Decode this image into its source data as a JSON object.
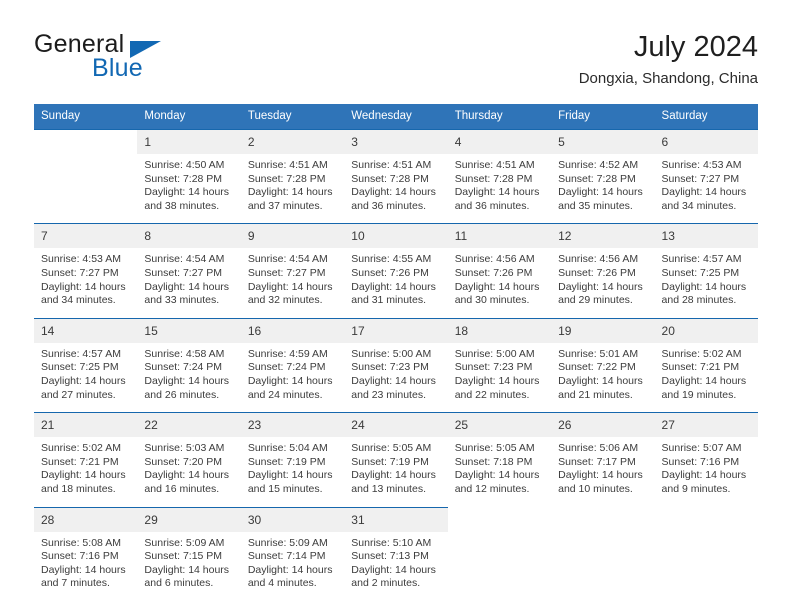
{
  "brand": {
    "name_part1": "General",
    "name_part2": "Blue",
    "logo_icon": "triangle-logo-icon",
    "color": "#1268b3"
  },
  "header": {
    "title": "July 2024",
    "location": "Dongxia, Shandong, China"
  },
  "theme": {
    "header_blue": "#2f74b8",
    "rule_blue": "#1667ad",
    "daynum_band": "#f0f0f0"
  },
  "calendar": {
    "weekdays": [
      "Sunday",
      "Monday",
      "Tuesday",
      "Wednesday",
      "Thursday",
      "Friday",
      "Saturday"
    ],
    "weeks": [
      [
        {
          "day": "",
          "empty": true
        },
        {
          "day": "1",
          "sunrise": "Sunrise: 4:50 AM",
          "sunset": "Sunset: 7:28 PM",
          "daylight1": "Daylight: 14 hours",
          "daylight2": "and 38 minutes."
        },
        {
          "day": "2",
          "sunrise": "Sunrise: 4:51 AM",
          "sunset": "Sunset: 7:28 PM",
          "daylight1": "Daylight: 14 hours",
          "daylight2": "and 37 minutes."
        },
        {
          "day": "3",
          "sunrise": "Sunrise: 4:51 AM",
          "sunset": "Sunset: 7:28 PM",
          "daylight1": "Daylight: 14 hours",
          "daylight2": "and 36 minutes."
        },
        {
          "day": "4",
          "sunrise": "Sunrise: 4:51 AM",
          "sunset": "Sunset: 7:28 PM",
          "daylight1": "Daylight: 14 hours",
          "daylight2": "and 36 minutes."
        },
        {
          "day": "5",
          "sunrise": "Sunrise: 4:52 AM",
          "sunset": "Sunset: 7:28 PM",
          "daylight1": "Daylight: 14 hours",
          "daylight2": "and 35 minutes."
        },
        {
          "day": "6",
          "sunrise": "Sunrise: 4:53 AM",
          "sunset": "Sunset: 7:27 PM",
          "daylight1": "Daylight: 14 hours",
          "daylight2": "and 34 minutes."
        }
      ],
      [
        {
          "day": "7",
          "sunrise": "Sunrise: 4:53 AM",
          "sunset": "Sunset: 7:27 PM",
          "daylight1": "Daylight: 14 hours",
          "daylight2": "and 34 minutes."
        },
        {
          "day": "8",
          "sunrise": "Sunrise: 4:54 AM",
          "sunset": "Sunset: 7:27 PM",
          "daylight1": "Daylight: 14 hours",
          "daylight2": "and 33 minutes."
        },
        {
          "day": "9",
          "sunrise": "Sunrise: 4:54 AM",
          "sunset": "Sunset: 7:27 PM",
          "daylight1": "Daylight: 14 hours",
          "daylight2": "and 32 minutes."
        },
        {
          "day": "10",
          "sunrise": "Sunrise: 4:55 AM",
          "sunset": "Sunset: 7:26 PM",
          "daylight1": "Daylight: 14 hours",
          "daylight2": "and 31 minutes."
        },
        {
          "day": "11",
          "sunrise": "Sunrise: 4:56 AM",
          "sunset": "Sunset: 7:26 PM",
          "daylight1": "Daylight: 14 hours",
          "daylight2": "and 30 minutes."
        },
        {
          "day": "12",
          "sunrise": "Sunrise: 4:56 AM",
          "sunset": "Sunset: 7:26 PM",
          "daylight1": "Daylight: 14 hours",
          "daylight2": "and 29 minutes."
        },
        {
          "day": "13",
          "sunrise": "Sunrise: 4:57 AM",
          "sunset": "Sunset: 7:25 PM",
          "daylight1": "Daylight: 14 hours",
          "daylight2": "and 28 minutes."
        }
      ],
      [
        {
          "day": "14",
          "sunrise": "Sunrise: 4:57 AM",
          "sunset": "Sunset: 7:25 PM",
          "daylight1": "Daylight: 14 hours",
          "daylight2": "and 27 minutes."
        },
        {
          "day": "15",
          "sunrise": "Sunrise: 4:58 AM",
          "sunset": "Sunset: 7:24 PM",
          "daylight1": "Daylight: 14 hours",
          "daylight2": "and 26 minutes."
        },
        {
          "day": "16",
          "sunrise": "Sunrise: 4:59 AM",
          "sunset": "Sunset: 7:24 PM",
          "daylight1": "Daylight: 14 hours",
          "daylight2": "and 24 minutes."
        },
        {
          "day": "17",
          "sunrise": "Sunrise: 5:00 AM",
          "sunset": "Sunset: 7:23 PM",
          "daylight1": "Daylight: 14 hours",
          "daylight2": "and 23 minutes."
        },
        {
          "day": "18",
          "sunrise": "Sunrise: 5:00 AM",
          "sunset": "Sunset: 7:23 PM",
          "daylight1": "Daylight: 14 hours",
          "daylight2": "and 22 minutes."
        },
        {
          "day": "19",
          "sunrise": "Sunrise: 5:01 AM",
          "sunset": "Sunset: 7:22 PM",
          "daylight1": "Daylight: 14 hours",
          "daylight2": "and 21 minutes."
        },
        {
          "day": "20",
          "sunrise": "Sunrise: 5:02 AM",
          "sunset": "Sunset: 7:21 PM",
          "daylight1": "Daylight: 14 hours",
          "daylight2": "and 19 minutes."
        }
      ],
      [
        {
          "day": "21",
          "sunrise": "Sunrise: 5:02 AM",
          "sunset": "Sunset: 7:21 PM",
          "daylight1": "Daylight: 14 hours",
          "daylight2": "and 18 minutes."
        },
        {
          "day": "22",
          "sunrise": "Sunrise: 5:03 AM",
          "sunset": "Sunset: 7:20 PM",
          "daylight1": "Daylight: 14 hours",
          "daylight2": "and 16 minutes."
        },
        {
          "day": "23",
          "sunrise": "Sunrise: 5:04 AM",
          "sunset": "Sunset: 7:19 PM",
          "daylight1": "Daylight: 14 hours",
          "daylight2": "and 15 minutes."
        },
        {
          "day": "24",
          "sunrise": "Sunrise: 5:05 AM",
          "sunset": "Sunset: 7:19 PM",
          "daylight1": "Daylight: 14 hours",
          "daylight2": "and 13 minutes."
        },
        {
          "day": "25",
          "sunrise": "Sunrise: 5:05 AM",
          "sunset": "Sunset: 7:18 PM",
          "daylight1": "Daylight: 14 hours",
          "daylight2": "and 12 minutes."
        },
        {
          "day": "26",
          "sunrise": "Sunrise: 5:06 AM",
          "sunset": "Sunset: 7:17 PM",
          "daylight1": "Daylight: 14 hours",
          "daylight2": "and 10 minutes."
        },
        {
          "day": "27",
          "sunrise": "Sunrise: 5:07 AM",
          "sunset": "Sunset: 7:16 PM",
          "daylight1": "Daylight: 14 hours",
          "daylight2": "and 9 minutes."
        }
      ],
      [
        {
          "day": "28",
          "sunrise": "Sunrise: 5:08 AM",
          "sunset": "Sunset: 7:16 PM",
          "daylight1": "Daylight: 14 hours",
          "daylight2": "and 7 minutes."
        },
        {
          "day": "29",
          "sunrise": "Sunrise: 5:09 AM",
          "sunset": "Sunset: 7:15 PM",
          "daylight1": "Daylight: 14 hours",
          "daylight2": "and 6 minutes."
        },
        {
          "day": "30",
          "sunrise": "Sunrise: 5:09 AM",
          "sunset": "Sunset: 7:14 PM",
          "daylight1": "Daylight: 14 hours",
          "daylight2": "and 4 minutes."
        },
        {
          "day": "31",
          "sunrise": "Sunrise: 5:10 AM",
          "sunset": "Sunset: 7:13 PM",
          "daylight1": "Daylight: 14 hours",
          "daylight2": "and 2 minutes."
        },
        {
          "day": "",
          "empty": true
        },
        {
          "day": "",
          "empty": true
        },
        {
          "day": "",
          "empty": true
        }
      ]
    ]
  }
}
